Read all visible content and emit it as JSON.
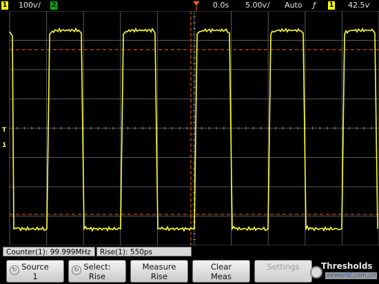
{
  "top_bar": {
    "ch1_number": "1",
    "ch1_scale": "100ѵ/",
    "ch2_number": "2",
    "time_delay": "0.0s",
    "time_scale": "5.00ѵ/",
    "trigger_mode": "Auto",
    "trigger_slope_symbol": "ƒ",
    "trigger_source_number": "1",
    "trigger_level": "42.5ѵ"
  },
  "markers": {
    "ch1_ground": "1",
    "trigger_level_marker": "T"
  },
  "measurements": [
    {
      "text": "Counter(1): 99.999MHz"
    },
    {
      "text": "Rise(1): 550ps"
    }
  ],
  "softkeys": [
    {
      "line1": "Source",
      "line2": "1",
      "enabled": true,
      "icon": "rotate-knob-icon"
    },
    {
      "line1": "Select:",
      "line2": "Rise",
      "enabled": true,
      "icon": "rotate-knob-icon"
    },
    {
      "line1": "Measure",
      "line2": "Rise",
      "enabled": true
    },
    {
      "line1": "Clear",
      "line2": "Meas",
      "enabled": true
    },
    {
      "line1": "Settings",
      "line2": "",
      "enabled": false
    }
  ],
  "watermark": {
    "text1": "Thresholds",
    "text2": "eeworld.com.cn"
  },
  "colors": {
    "trace": "#ffff30",
    "grid": "#5a5a5a",
    "cursor_orange": "#ff6a00",
    "ch1_yellow": "#ffff00",
    "ch2_green": "#00cc00"
  }
}
